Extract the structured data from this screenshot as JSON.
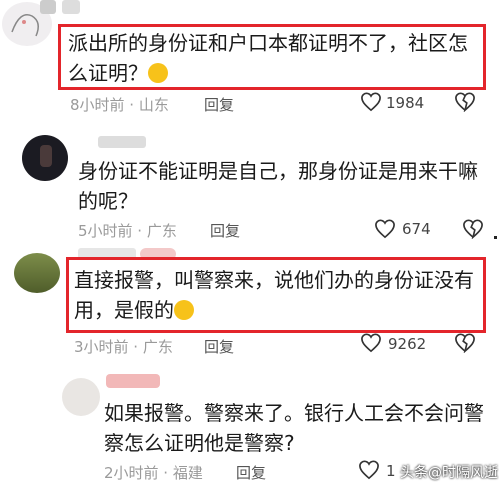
{
  "comments": [
    {
      "text": "派出所的身份证和户口本都证明不了，社区怎么证明？",
      "time": "8小时前 · 山东",
      "reply": "回复",
      "likes": "1984"
    },
    {
      "text": "身份证不能证明是自己，那身份证是用来干嘛的呢？",
      "time": "5小时前 · 广东",
      "reply": "回复",
      "likes": "674"
    },
    {
      "text": "直接报警，叫警察来，说他们办的身份证没有用，是假的",
      "time": "3小时前 · 广东",
      "reply": "回复",
      "likes": "9262"
    },
    {
      "text": "如果报警。警察来了。银行人工会不会问警察怎么证明他是警察?",
      "time": "2小时前 · 福建",
      "reply": "回复",
      "likes": "1"
    }
  ],
  "watermark": "头条@时隔风逝",
  "colors": {
    "highlight": "#e3252b",
    "meta": "#9a9a9a"
  }
}
